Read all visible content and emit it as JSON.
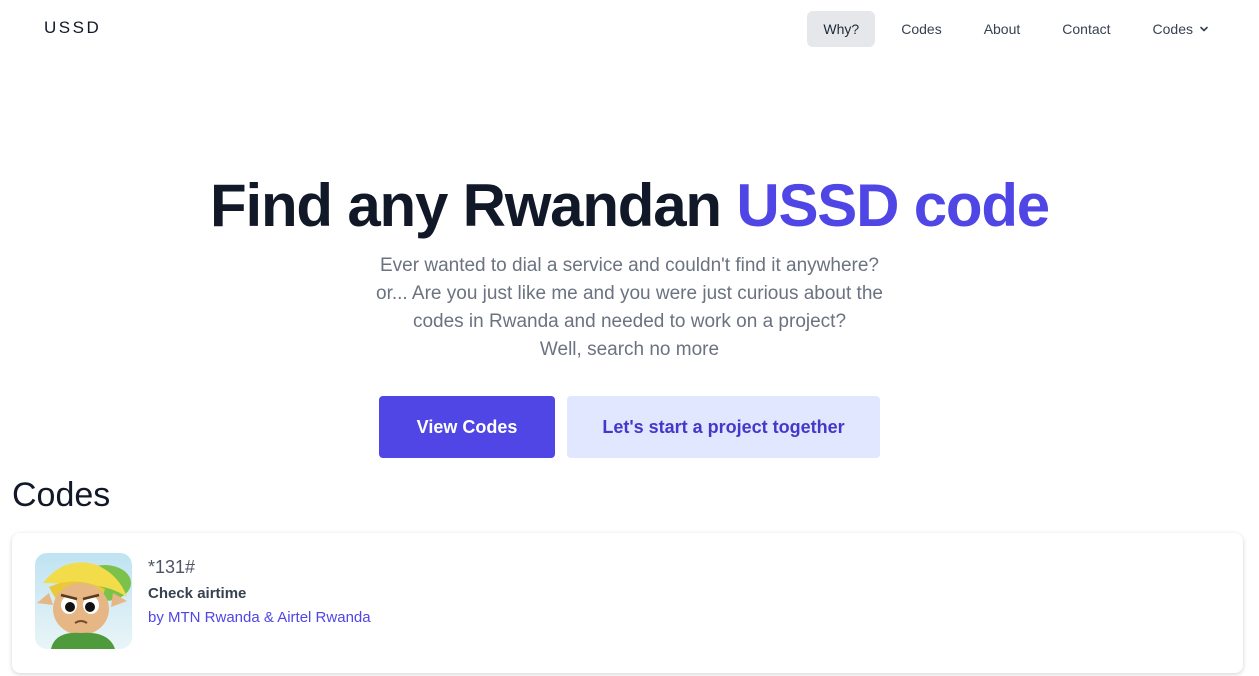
{
  "brand": {
    "logo_text": "USSD"
  },
  "nav": {
    "items": [
      {
        "label": "Why?"
      },
      {
        "label": "Codes"
      },
      {
        "label": "About"
      },
      {
        "label": "Contact"
      },
      {
        "label": "Codes"
      }
    ],
    "active_item": "Why?",
    "dropdown_icon": "chevron-down-icon"
  },
  "hero": {
    "title_main": "Find any Rwandan ",
    "title_accent": "USSD code",
    "description_lines": [
      "Ever wanted to dial a service and couldn't find it anywhere?",
      "or... Are you just like me and you were just curious about the",
      "codes in Rwanda and needed to work on a project?",
      "Well, search no more"
    ],
    "primary_button": "View Codes",
    "secondary_button": "Let's start a project together"
  },
  "codes_section": {
    "heading": "Codes",
    "items": [
      {
        "code": "*131#",
        "title": "Check airtime",
        "provider": "by MTN Rwanda & Airtel Rwanda",
        "image": "cartoon-character-avatar"
      }
    ]
  },
  "colors": {
    "accent": "#4f46e5",
    "accent_light": "#e0e7ff",
    "text_dark": "#111827",
    "text_muted": "#6b7280",
    "nav_active_bg": "#e5e7eb"
  }
}
